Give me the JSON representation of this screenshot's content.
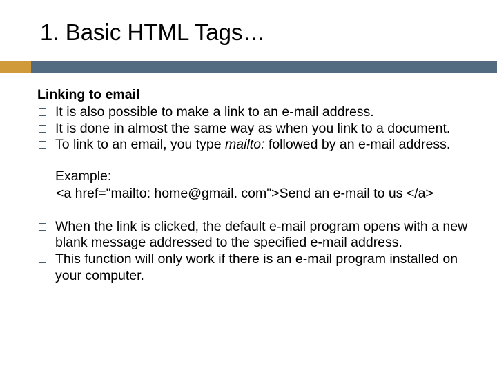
{
  "title": "1. Basic HTML Tags…",
  "subheading": "Linking to email",
  "bullets": {
    "b1": "It is also possible to make a link to an e-mail address.",
    "b2": "It is done in almost the same way as when you link to a document.",
    "b3_before": "To link to an email, you type ",
    "b3_italic": "mailto:",
    "b3_after": " followed by an e-mail address.",
    "b4": "Example:",
    "b4_code": "<a href=\"mailto: home@gmail. com\">Send an e-mail to us </a>",
    "b5": "When the link is clicked, the default e-mail program opens with a new blank message addressed to the specified e-mail address.",
    "b6": "This function will only work if there is an e-mail program installed on your computer."
  }
}
